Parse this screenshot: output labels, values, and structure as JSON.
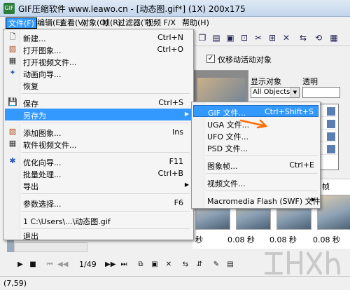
{
  "window": {
    "title": "GIF压缩软件 www.leawo.cn - [动态图.gif*] (1X) 200x175"
  },
  "menubar": [
    {
      "label": "文件(F)",
      "active": true
    },
    {
      "label": "编辑(E)"
    },
    {
      "label": "查看(V)"
    },
    {
      "label": "对象(O)"
    },
    {
      "label": "帧(R)"
    },
    {
      "label": "过滤器(T)"
    },
    {
      "label": "视频 F/X"
    },
    {
      "label": "帮助(H)"
    }
  ],
  "file_menu": [
    {
      "label": "新建...",
      "shortcut": "Ctrl+N",
      "icon": "new-file-icon"
    },
    {
      "label": "打开图象...",
      "shortcut": "Ctrl+O",
      "icon": "open-image-icon"
    },
    {
      "label": "打开视频文件...",
      "shortcut": "",
      "icon": "open-video-icon"
    },
    {
      "label": "动画向导...",
      "shortcut": "",
      "icon": "wizard-icon"
    },
    {
      "label": "恢复",
      "shortcut": ""
    },
    {
      "separator": true
    },
    {
      "label": "保存",
      "shortcut": "Ctrl+S",
      "icon": "save-icon"
    },
    {
      "label": "另存为",
      "shortcut": "",
      "submenu": true,
      "highlighted": true
    },
    {
      "separator": true
    },
    {
      "label": "添加图象...",
      "shortcut": "Ins",
      "icon": "add-image-icon"
    },
    {
      "label": "软件视频文件...",
      "shortcut": "",
      "icon": "video-file-icon"
    },
    {
      "separator": true
    },
    {
      "label": "优化向导...",
      "shortcut": "F11",
      "icon": "optimize-icon"
    },
    {
      "label": "批量处理...",
      "shortcut": "Ctrl+B"
    },
    {
      "label": "导出",
      "shortcut": "",
      "submenu": true
    },
    {
      "separator": true
    },
    {
      "label": "参数选择...",
      "shortcut": "F6"
    },
    {
      "separator": true
    },
    {
      "label": "1 C:\\Users\\...\\动态图.gif",
      "shortcut": ""
    },
    {
      "separator": true
    },
    {
      "label": "退出",
      "shortcut": ""
    }
  ],
  "saveas_menu": [
    {
      "label": "GIF 文件...",
      "shortcut": "Ctrl+Shift+S",
      "highlighted": true
    },
    {
      "label": "UGA 文件...",
      "shortcut": ""
    },
    {
      "label": "UFO 文件...",
      "shortcut": ""
    },
    {
      "label": "PSD 文件...",
      "shortcut": ""
    },
    {
      "separator": true
    },
    {
      "label": "图象帧...",
      "shortcut": "Ctrl+E"
    },
    {
      "separator": true
    },
    {
      "label": "视频文件...",
      "shortcut": ""
    },
    {
      "separator": true
    },
    {
      "label": "Macromedia Flash (SWF) 文件",
      "shortcut": "",
      "submenu": true
    }
  ],
  "options": {
    "move_active_only_label": "仅移动活动对象",
    "checked": true
  },
  "right_panel": {
    "display_label": "显示对象",
    "transparency_label": "透明",
    "display_select": "All Objects"
  },
  "frames": {
    "header": "帧",
    "times": [
      "秒",
      "0.08 秒",
      "0.08 秒",
      "0.08 秒"
    ]
  },
  "playbar": {
    "counter": "1/49"
  },
  "status": {
    "coords": "(7,59)"
  }
}
